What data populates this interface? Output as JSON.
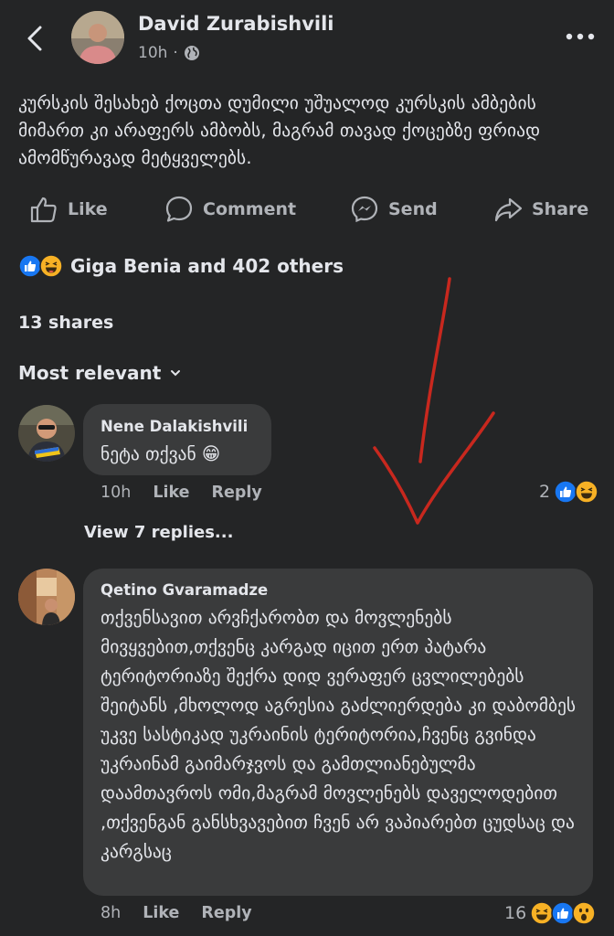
{
  "header": {
    "author": "David Zurabishvili",
    "time": "10h",
    "separator": "·"
  },
  "post": {
    "text": "კურსკის შესახებ ქოცთა დუმილი უშუალოდ კურსკის ამბების მიმართ კი არაფერს ამბობს, მაგრამ თავად ქოცებზე ფრიად ამომწურავად მეტყველებს."
  },
  "actions": {
    "like": "Like",
    "comment": "Comment",
    "send": "Send",
    "share": "Share"
  },
  "reactions": {
    "summary": "Giga Benia and 402 others"
  },
  "shares": "13 shares",
  "sort": "Most relevant",
  "comments": [
    {
      "name": "Nene Dalakishvili",
      "text": "ნეტა თქვან 😁",
      "time": "10h",
      "like": "Like",
      "reply": "Reply",
      "reaction_count": "2"
    },
    {
      "name": "Qetino Gvaramadze",
      "text": "თქვენსავით არვჩქარობთ და მოვლენებს მივყვებით,თქვენც კარგად იცით ერთ პატარა ტერიტორიაზე შექრა დიდ ვერაფერ ცვლილებებს შეიტანს ,მხოლოდ აგრესია გაძლიერდება კი დაბომბეს უკვე სასტიკად უკრაინის ტერიტორია,ჩვენც გვინდა უკრაინამ გაიმარჯვოს და გამთლიანებულმა დაამთავროს ომი,მაგრამ მოვლენებს დაველოდებით ,თქვენგან განსხვავებით ჩვენ არ ვაპიარებთ ცუდსაც და კარგსაც",
      "time": "8h",
      "like": "Like",
      "reply": "Reply",
      "reaction_count": "16"
    }
  ],
  "view_replies": "View 7 replies...",
  "colors": {
    "background": "#242526",
    "bubble": "#3a3b3c",
    "text": "#e4e6eb",
    "secondary": "#b0b3b8",
    "like_blue": "#1877f2",
    "haha_yellow": "#f7b125",
    "arrow_red": "#c8281e"
  }
}
